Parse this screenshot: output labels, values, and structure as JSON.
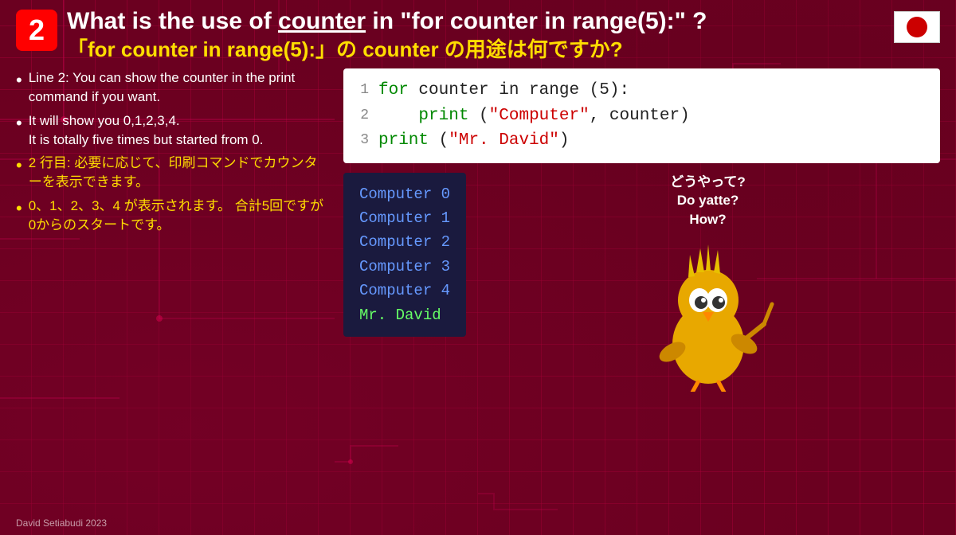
{
  "header": {
    "question_number": "2",
    "title_part1": "What is the use of ",
    "title_underline": "counter",
    "title_part2": " in \"for counter in range(5):\" ?",
    "subtitle": "「for counter in range(5):」の counter の用途は何ですか?",
    "flag_emoji": "🇯🇵"
  },
  "bullets": [
    {
      "english": "Line 2: You can show the counter in the print command if you want.",
      "japanese": ""
    },
    {
      "english": "It will show you 0,1,2,3,4.\nIt is totally five times but started from 0.",
      "japanese": ""
    },
    {
      "english": "",
      "japanese": "2 行目: 必要に応じて、印刷コマンドでカウンターを表示できます。"
    },
    {
      "english": "",
      "japanese": "0、1、2、3、4 が表示されます。 合計5回ですが0からのスタートです。"
    }
  ],
  "code": {
    "lines": [
      {
        "num": "1",
        "content": "for counter in range (5):"
      },
      {
        "num": "2",
        "content": "    print (\"Computer\", counter)"
      },
      {
        "num": "3",
        "content": "print (\"Mr. David\")"
      }
    ]
  },
  "output": {
    "lines": [
      "Computer 0",
      "Computer 1",
      "Computer 2",
      "Computer 3",
      "Computer 4",
      "Mr. David"
    ]
  },
  "mascot": {
    "text1": "どうやって?",
    "text2": "Do yatte?",
    "text3": "How?"
  },
  "footer": {
    "text": "David Setiabudi 2023"
  }
}
